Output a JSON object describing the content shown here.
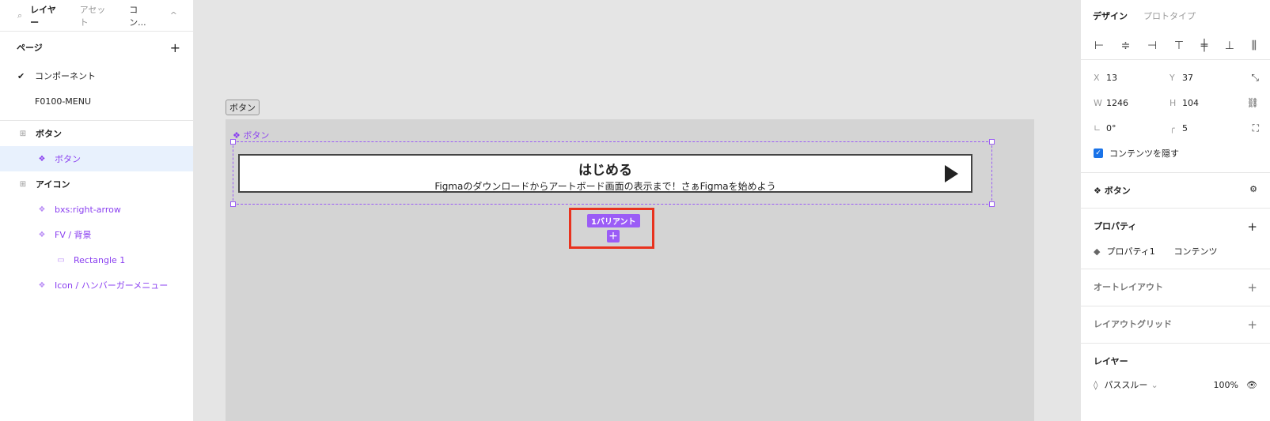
{
  "left_panel": {
    "tabs": [
      "レイヤー",
      "アセット",
      "コン..."
    ],
    "pages_header": "ページ",
    "pages": [
      {
        "label": "コンポーネント",
        "checked": true
      },
      {
        "label": "F0100-MENU",
        "checked": false
      }
    ],
    "layers": [
      {
        "label": "ボタン",
        "indent": 0,
        "icon": "frame-icon",
        "selected": false,
        "purple": false
      },
      {
        "label": "ボタン",
        "indent": 1,
        "icon": "component-icon",
        "selected": true,
        "purple": true
      },
      {
        "label": "アイコン",
        "indent": 0,
        "icon": "frame-icon",
        "selected": false,
        "purple": false
      },
      {
        "label": "bxs:right-arrow",
        "indent": 1,
        "icon": "component-icon",
        "selected": false,
        "purple": true
      },
      {
        "label": "FV / 背景",
        "indent": 1,
        "icon": "component-icon",
        "selected": false,
        "purple": true
      },
      {
        "label": "Rectangle 1",
        "indent": 2,
        "icon": "rectangle-icon",
        "selected": false,
        "purple": true
      },
      {
        "label": "Icon / ハンバーガーメニュー",
        "indent": 1,
        "icon": "component-icon",
        "selected": false,
        "purple": true
      }
    ]
  },
  "canvas": {
    "frame_label": "ボタン",
    "component_label": "ボタン",
    "button_title": "はじめる",
    "button_subtitle": "Figmaのダウンロードからアートボード画面の表示まで！さぁFigmaを始めよう",
    "variant_chip": "1バリアント"
  },
  "right_panel": {
    "tabs": [
      "デザイン",
      "プロトタイプ"
    ],
    "x": "13",
    "y": "37",
    "w": "1246",
    "h": "104",
    "rotation": "0°",
    "radius": "5",
    "clip_content": "コンテンツを隠す",
    "component_name": "ボタン",
    "properties_header": "プロパティ",
    "property_name": "プロパティ1",
    "property_value": "コンテンツ",
    "auto_layout": "オートレイアウト",
    "layout_grid": "レイアウトグリッド",
    "layer_header": "レイヤー",
    "blend_mode": "パススルー",
    "opacity": "100%"
  },
  "colors": {
    "accent": "#9b5cf6",
    "highlight": "#e8321e",
    "selection": "#e8f1fd"
  }
}
